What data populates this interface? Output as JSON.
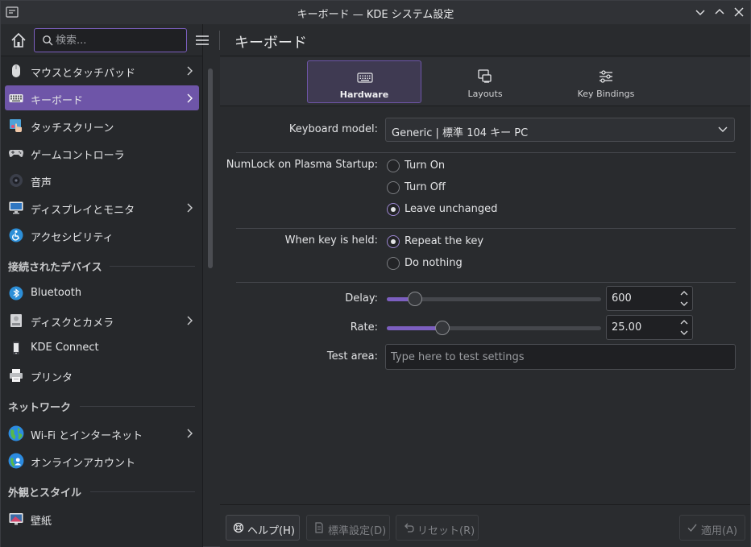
{
  "window": {
    "title": "キーボード — KDE システム設定"
  },
  "search": {
    "placeholder": "検索..."
  },
  "sidebar": {
    "items": [
      {
        "label": "マウスとタッチパッド",
        "icon": "mouse-icon"
      },
      {
        "label": "キーボード",
        "icon": "keyboard-icon",
        "selected": true
      },
      {
        "label": "タッチスクリーン",
        "icon": "touchscreen-icon"
      },
      {
        "label": "ゲームコントローラ",
        "icon": "gamepad-icon"
      },
      {
        "label": "音声",
        "icon": "speaker-icon"
      },
      {
        "label": "ディスプレイとモニタ",
        "icon": "monitor-icon"
      },
      {
        "label": "アクセシビリティ",
        "icon": "accessibility-icon"
      }
    ],
    "sections": {
      "devices": "接続されたデバイス",
      "network": "ネットワーク",
      "appearance": "外観とスタイル"
    },
    "device_items": [
      {
        "label": "Bluetooth",
        "icon": "bluetooth-icon"
      },
      {
        "label": "ディスクとカメラ",
        "icon": "disk-icon"
      },
      {
        "label": "KDE Connect",
        "icon": "phone-icon"
      },
      {
        "label": "プリンタ",
        "icon": "printer-icon"
      }
    ],
    "network_items": [
      {
        "label": "Wi-Fi とインターネット",
        "icon": "globe-icon"
      },
      {
        "label": "オンラインアカウント",
        "icon": "online-accounts-icon"
      }
    ],
    "appearance_items": [
      {
        "label": "壁紙",
        "icon": "wallpaper-icon"
      }
    ]
  },
  "page": {
    "title": "キーボード"
  },
  "tabs": [
    {
      "label": "Hardware",
      "icon": "keyboard-icon",
      "active": true
    },
    {
      "label": "Layouts",
      "icon": "layouts-icon"
    },
    {
      "label": "Key Bindings",
      "icon": "key-bindings-icon"
    }
  ],
  "form": {
    "keyboard_model_label": "Keyboard model:",
    "keyboard_model_value": "Generic | 標準 104 キー PC",
    "numlock_label": "NumLock on Plasma Startup:",
    "numlock_options": [
      "Turn On",
      "Turn Off",
      "Leave unchanged"
    ],
    "numlock_selected": "Leave unchanged",
    "held_label": "When key is held:",
    "held_options": [
      "Repeat the key",
      "Do nothing"
    ],
    "held_selected": "Repeat the key",
    "delay_label": "Delay:",
    "delay_value": "600",
    "delay_fraction": 0.13,
    "rate_label": "Rate:",
    "rate_value": "25.00",
    "rate_fraction": 0.26,
    "test_label": "Test area:",
    "test_placeholder": "Type here to test settings"
  },
  "footer": {
    "help": "ヘルプ(H)",
    "defaults": "標準設定(D)",
    "reset": "リセット(R)",
    "apply": "適用(A)"
  },
  "colors": {
    "accent": "#6e55a8",
    "accent_border": "#7c5fc0",
    "background": "#292b2e"
  }
}
